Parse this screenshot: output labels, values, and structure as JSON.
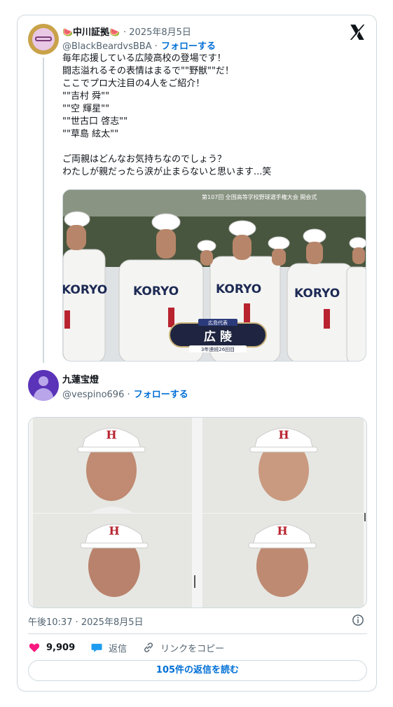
{
  "tweet": {
    "emoji_left": "🍉",
    "author_name": "中川証拠",
    "emoji_right": "🍉",
    "date_prefix": "· 2025年8月5日",
    "handle": "@BlackBeardvsBBA ·",
    "follow_label": "フォローする",
    "body": "毎年応援している広陵高校の登場です！\n闘志溢れるその表情はまるで\"\"野獣\"\"だ！\nここでプロ大注目の4人をご紹介！\n\"\"吉村 舜\"\"\n\"\"空 輝星\"\"\n\"\"世古口 啓志\"\"\n\"\"草島 絃太\"\"\n\nご両親はどんなお気持ちなのでしょう？\nわたしが親だったら涙が止まらないと思います...笑",
    "image": {
      "broadcast_caption": "第107回 全国高等学校野球選手権大会 開会式",
      "uniform_text": "KORYO",
      "banner_small": "広島代表",
      "banner_school": "広 陵",
      "banner_bottom": "3年連続26回目"
    }
  },
  "quoted": {
    "author_name": "九蓮宝燈",
    "handle": "@vespino696 ·",
    "follow_label": "フォローする"
  },
  "footer": {
    "timestamp": "午後10:37 · 2025年8月5日",
    "likes": "9,909",
    "reply_label": "返信",
    "copy_link_label": "リンクをコピー",
    "read_replies": "105件の返信を読む"
  },
  "colors": {
    "like": "#f91880",
    "reply": "#1d9bf0",
    "link": "#006fd6",
    "uniform_red": "#b8232f"
  },
  "icons": [
    "x-logo-icon",
    "info-icon",
    "heart-icon",
    "reply-icon",
    "link-icon"
  ]
}
